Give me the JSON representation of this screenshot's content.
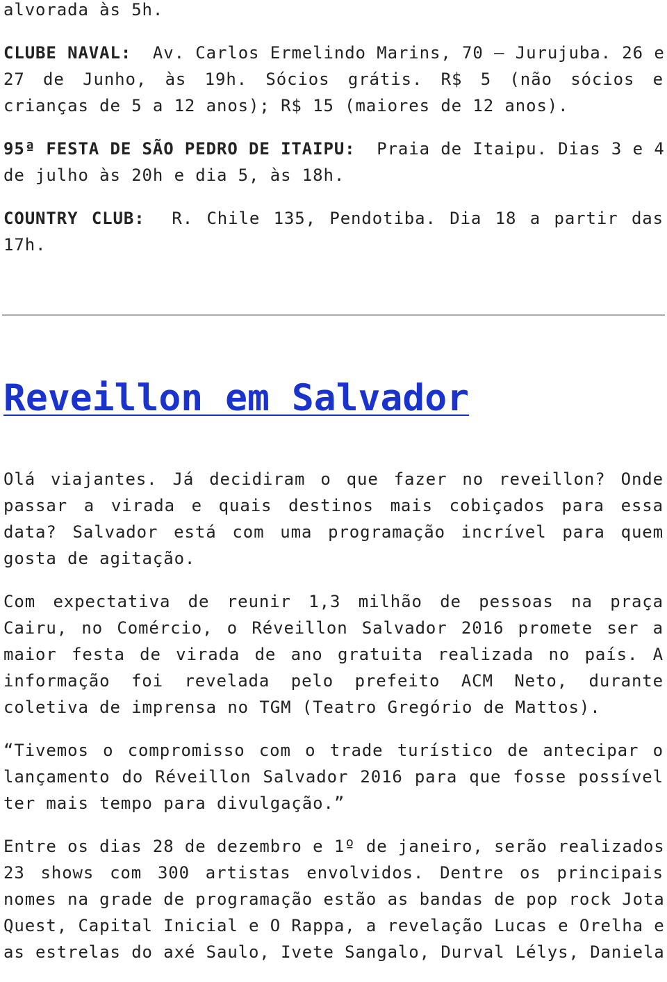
{
  "intro": {
    "lines": [
      "alvorada às 5h."
    ]
  },
  "clube_naval": {
    "label": "CLUBE NAVAL:",
    "lines": [
      "Av. Carlos Ermelindo Marins, 70 – Jurujuba. 26 e",
      "27 de Junho, às 19h. Sócios grátis. R$ 5 (não sócios e",
      "crianças de 5 a 12 anos); R$ 15 (maiores de 12 anos)."
    ]
  },
  "sao_pedro": {
    "label": "95ª FESTA DE SÃO PEDRO DE ITAIPU:",
    "lines": [
      "Praia de Itaipu. Dias 3 e 4",
      "de julho às 20h e dia 5, às 18h."
    ]
  },
  "country": {
    "label": "COUNTRY CLUB:",
    "lines": [
      "R. Chile 135, Pendotiba. Dia 18 a partir das",
      "17h."
    ]
  },
  "article": {
    "title": "Reveillon em Salvador",
    "link_color": "#1a33cc",
    "paragraphs": [
      [
        "Olá viajantes. Já decidiram o que fazer no reveillon? Onde",
        "passar a virada e quais destinos mais cobiçados para essa",
        "data? Salvador está com uma programação incrível para quem",
        "gosta de agitação."
      ],
      [
        "Com expectativa de reunir 1,3 milhão de pessoas na praça",
        "Cairu, no Comércio, o Réveillon Salvador 2016 promete ser a",
        "maior festa de virada de ano gratuita realizada no país. A",
        "informação foi revelada pelo prefeito ACM Neto, durante",
        "coletiva de imprensa no TGM (Teatro Gregório de Mattos)."
      ],
      [
        "“Tivemos o compromisso com o trade turístico de antecipar o",
        "lançamento do Réveillon Salvador 2016 para que fosse possível",
        "ter mais tempo para divulgação.”"
      ],
      [
        "Entre os dias 28 de dezembro e 1º de janeiro, serão realizados",
        "23 shows com 300 artistas envolvidos. Dentre os principais",
        "nomes na grade de programação estão as bandas de pop rock Jota",
        "Quest, Capital Inicial e O Rappa, a revelação Lucas e Orelha e",
        "as estrelas do axé Saulo, Ivete Sangalo, Durval Lélys, Daniela"
      ]
    ]
  }
}
